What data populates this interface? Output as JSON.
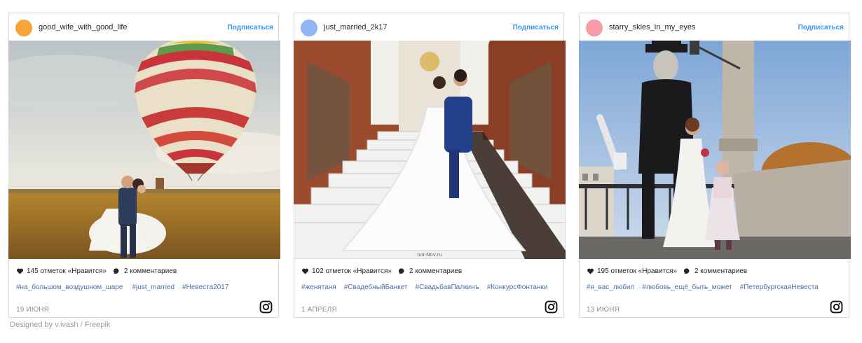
{
  "posts": [
    {
      "username": "good_wife_with_good_life",
      "follow_label": "Подписаться",
      "avatar_color": "#f7a43a",
      "likes": "145 отметок «Нравится»",
      "comments": "2 комментариев",
      "tags": [
        "#на_большом_воздушном_шаре",
        "#just_married",
        "#Невеста2017"
      ],
      "date": "19 ИЮНЯ",
      "photo_desc": "hot-air-balloon-field-icon"
    },
    {
      "username": "just_married_2k17",
      "follow_label": "Подписаться",
      "avatar_color": "#8fb5f2",
      "likes": "102 отметок «Нравится»",
      "comments": "2 комментариев",
      "tags": [
        "#женятаня",
        "#СвадебныйБанкет",
        "#СвадьбавПалкинъ",
        "#КонкурсФонтанки"
      ],
      "date": "1 АПРЕЛЯ",
      "photo_watermark": "Iva-Nov.ru"
    },
    {
      "username": "starry_skies_in_my_eyes",
      "follow_label": "Подписаться",
      "avatar_color": "#f59ca6",
      "likes": "195 отметок «Нравится»",
      "comments": "2 комментариев",
      "tags": [
        "#я_вас_любил",
        "#любовь_ещё_быть_может",
        "#ПетербургскаяНевеста"
      ],
      "date": "13 ИЮНЯ"
    }
  ],
  "credit": "Designed by v.ivash / Freepik"
}
